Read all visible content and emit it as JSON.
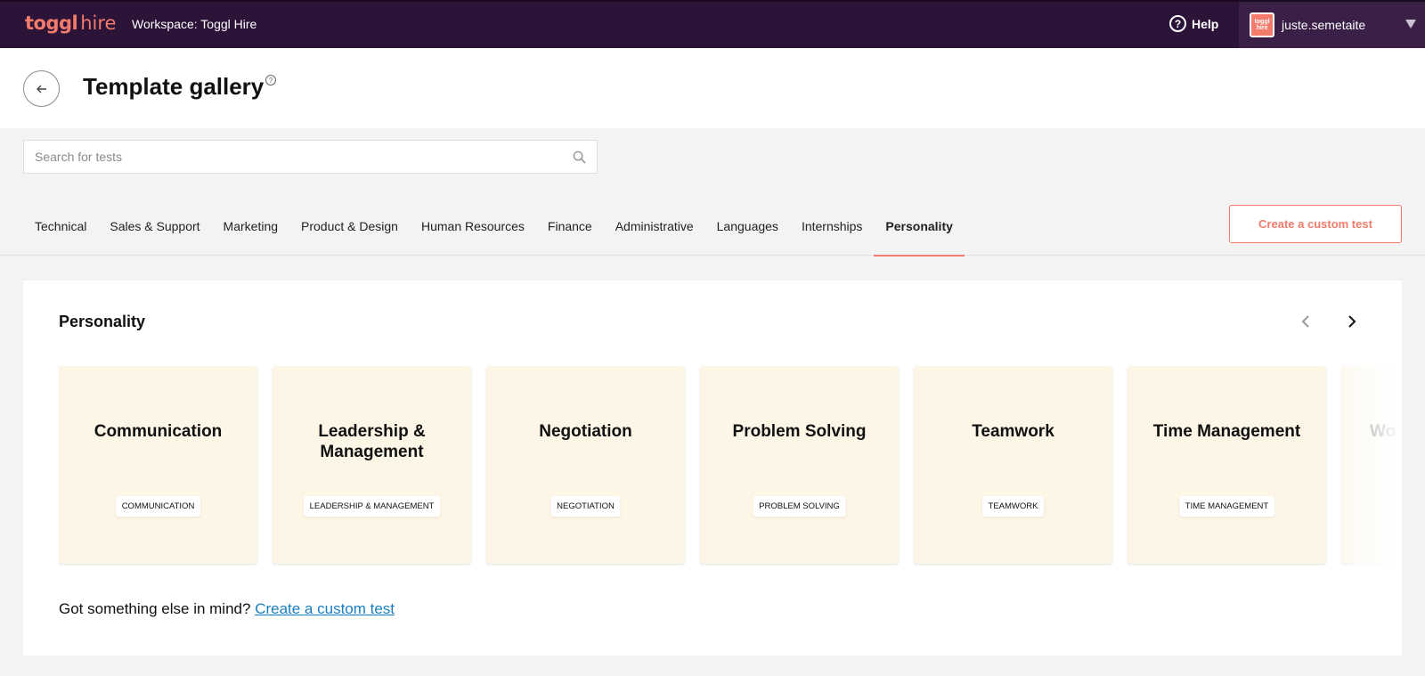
{
  "topbar": {
    "logo_primary": "toggl",
    "logo_secondary": "hire",
    "workspace": "Workspace: Toggl Hire",
    "help_label": "Help",
    "user_name": "juste.semetaite",
    "avatar_text": "toggl hire"
  },
  "header": {
    "title": "Template gallery"
  },
  "search": {
    "placeholder": "Search for tests",
    "value": ""
  },
  "tabs": [
    {
      "label": "Technical",
      "active": false
    },
    {
      "label": "Sales & Support",
      "active": false
    },
    {
      "label": "Marketing",
      "active": false
    },
    {
      "label": "Product & Design",
      "active": false
    },
    {
      "label": "Human Resources",
      "active": false
    },
    {
      "label": "Finance",
      "active": false
    },
    {
      "label": "Administrative",
      "active": false
    },
    {
      "label": "Languages",
      "active": false
    },
    {
      "label": "Internships",
      "active": false
    },
    {
      "label": "Personality",
      "active": true
    }
  ],
  "create_button": "Create a custom test",
  "section": {
    "title": "Personality",
    "cards": [
      {
        "title": "Communication",
        "tag": "COMMUNICATION"
      },
      {
        "title": "Leadership & Management",
        "tag": "LEADERSHIP & MANAGEMENT"
      },
      {
        "title": "Negotiation",
        "tag": "NEGOTIATION"
      },
      {
        "title": "Problem Solving",
        "tag": "PROBLEM SOLVING"
      },
      {
        "title": "Teamwork",
        "tag": "TEAMWORK"
      },
      {
        "title": "Time Management",
        "tag": "TIME MANAGEMENT"
      },
      {
        "title": "Wo",
        "tag": ""
      }
    ]
  },
  "footer": {
    "text": "Got something else in mind?",
    "link": "Create a custom test"
  },
  "colors": {
    "topbar_bg": "#2c1338",
    "accent": "#f27b6b",
    "card_bg": "#fdf5e6",
    "link": "#1a7fc1"
  },
  "icons": [
    "question-circle-icon",
    "back-arrow-icon",
    "search-icon",
    "chevron-left-icon",
    "chevron-right-icon",
    "caret-down-icon"
  ]
}
